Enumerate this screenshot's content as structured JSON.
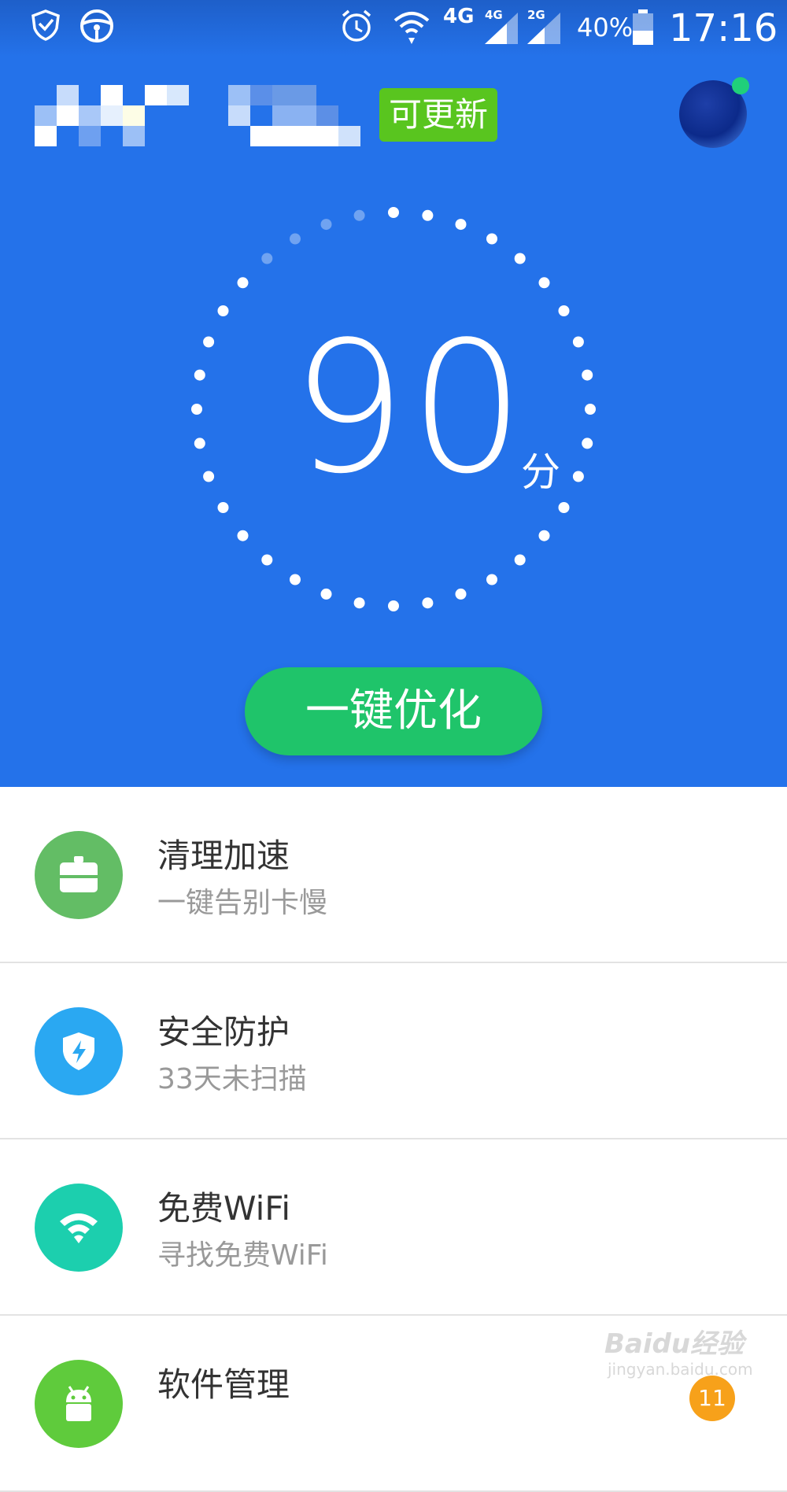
{
  "status_bar": {
    "network_label": "4G",
    "sim1_tag": "4G",
    "sim2_tag": "2G",
    "battery_percent": "40%",
    "time": "17:16"
  },
  "header": {
    "update_badge": "可更新"
  },
  "score": {
    "value": "90",
    "unit": "分"
  },
  "optimize_button": "一键优化",
  "features": [
    {
      "title": "清理加速",
      "subtitle": "一键告别卡慢",
      "icon": "briefcase-icon",
      "color": "#63bd65"
    },
    {
      "title": "安全防护",
      "subtitle": "33天未扫描",
      "icon": "shield-bolt-icon",
      "color": "#2aa8f2"
    },
    {
      "title": "免费WiFi",
      "subtitle": "寻找免费WiFi",
      "icon": "wifi-icon",
      "color": "#1ccfae"
    },
    {
      "title": "软件管理",
      "subtitle": "",
      "icon": "android-icon",
      "color": "#5fcb3c"
    }
  ],
  "notification_count": "11",
  "watermark": {
    "brand": "Baidu经验",
    "url": "jingyan.baidu.com"
  },
  "colors": {
    "header_blue": "#2472ea",
    "optimize_green": "#1fc46a",
    "update_green": "#59c51f",
    "badge_orange": "#f7a11a"
  }
}
